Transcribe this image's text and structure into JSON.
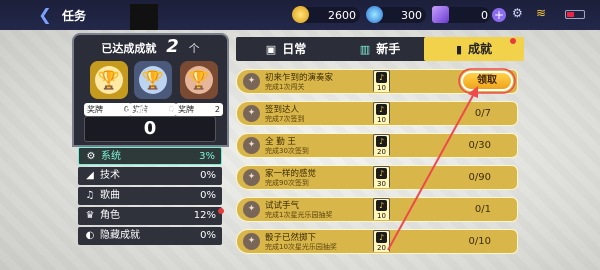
{
  "topbar": {
    "title": "任务",
    "currencies": [
      {
        "icon": "gold-coin-icon",
        "value": "2600"
      },
      {
        "icon": "blue-gem-icon",
        "value": "300"
      },
      {
        "icon": "purple-ticket-icon",
        "value": "0"
      }
    ]
  },
  "summary": {
    "achieved_label": "已达成成就",
    "achieved_count": "2",
    "achieved_unit": "个",
    "trophies": [
      {
        "name": "奖牌",
        "count": "0",
        "tier": "gold"
      },
      {
        "name": "奖牌",
        "count": "0",
        "tier": "silver"
      },
      {
        "name": "奖牌",
        "count": "2",
        "tier": "bronze"
      }
    ],
    "points_label": "总成就点数",
    "points_value": "0"
  },
  "categories": [
    {
      "label": "系统",
      "percent": "3%",
      "icon": "gear-icon",
      "selected": true
    },
    {
      "label": "技术",
      "percent": "0%",
      "icon": "tech-icon",
      "selected": false
    },
    {
      "label": "歌曲",
      "percent": "0%",
      "icon": "music-icon",
      "selected": false
    },
    {
      "label": "角色",
      "percent": "12%",
      "icon": "character-icon",
      "selected": false
    },
    {
      "label": "隐藏成就",
      "percent": "0%",
      "icon": "hidden-icon",
      "selected": false
    }
  ],
  "tabs": [
    {
      "label": "日常",
      "icon": "calendar-icon"
    },
    {
      "label": "新手",
      "icon": "book-icon"
    },
    {
      "label": "成就",
      "icon": "bookmark-icon"
    }
  ],
  "achievements": [
    {
      "name": "初来乍到的演奏家",
      "desc": "完成1次闯关",
      "reward": "10",
      "progress": "",
      "claim": "领取"
    },
    {
      "name": "签到达人",
      "desc": "完成7次签到",
      "reward": "10",
      "progress": "0/7",
      "claim": ""
    },
    {
      "name": "全 勤 王",
      "desc": "完成30次签到",
      "reward": "20",
      "progress": "0/30",
      "claim": ""
    },
    {
      "name": "家一样的感觉",
      "desc": "完成90次签到",
      "reward": "30",
      "progress": "0/90",
      "claim": ""
    },
    {
      "name": "试试手气",
      "desc": "完成1次星光乐园抽奖",
      "reward": "10",
      "progress": "0/1",
      "claim": ""
    },
    {
      "name": "骰子已然掷下",
      "desc": "完成10次星光乐园抽奖",
      "reward": "20",
      "progress": "0/10",
      "claim": ""
    }
  ],
  "colors": {
    "accent": "#f3d24b",
    "row": "#d9b64a",
    "teal": "#7ef5d9",
    "claim": "#f0a21b"
  }
}
